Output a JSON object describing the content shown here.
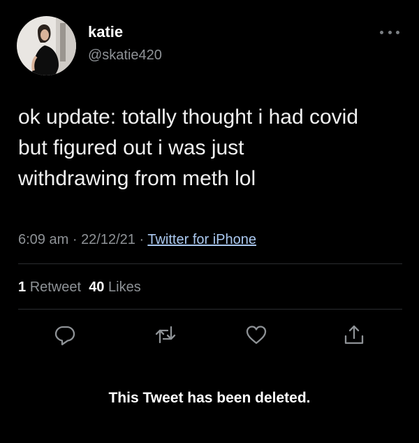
{
  "user": {
    "name": "katie",
    "handle": "@skatie420"
  },
  "tweet": {
    "text": "ok update: totally thought i had covid\nbut figured out i was just\nwithdrawing from meth lol",
    "time": "6:09 am",
    "date": "22/12/21",
    "source": "Twitter for iPhone",
    "separator": "·"
  },
  "stats": {
    "retweets_count": "1",
    "retweets_label": "Retweet",
    "likes_count": "40",
    "likes_label": "Likes"
  },
  "actions": [
    {
      "icon": "reply-icon"
    },
    {
      "icon": "retweet-icon"
    },
    {
      "icon": "like-icon"
    },
    {
      "icon": "share-icon"
    }
  ],
  "notice": "This Tweet has been deleted.",
  "colors": {
    "background": "#000000",
    "primary_text": "#ffffff",
    "secondary_text": "#8e9296",
    "link": "#aac8ef"
  }
}
